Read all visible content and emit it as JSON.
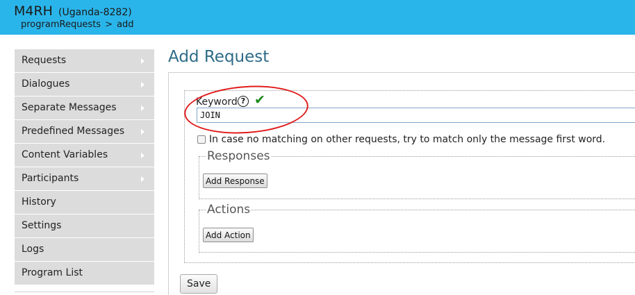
{
  "header": {
    "app_name": "M4RH",
    "program_name": "(Uganda-8282)",
    "breadcrumb": {
      "parent": "programRequests",
      "separator": ">",
      "current": "add"
    }
  },
  "sidebar": {
    "items": [
      {
        "label": "Requests",
        "has_submenu": true
      },
      {
        "label": "Dialogues",
        "has_submenu": true
      },
      {
        "label": "Separate Messages",
        "has_submenu": true
      },
      {
        "label": "Predefined Messages",
        "has_submenu": true
      },
      {
        "label": "Content Variables",
        "has_submenu": true
      },
      {
        "label": "Participants",
        "has_submenu": true
      },
      {
        "label": "History",
        "has_submenu": false
      },
      {
        "label": "Settings",
        "has_submenu": false
      },
      {
        "label": "Logs",
        "has_submenu": false
      },
      {
        "label": "Program List",
        "has_submenu": false
      }
    ]
  },
  "main": {
    "title": "Add Request",
    "keyword": {
      "label": "Keyword",
      "help_icon": "?",
      "value": "JOIN",
      "valid_icon": "✔"
    },
    "match_option": {
      "checked": false,
      "label": "In case no matching on other requests, try to match only the message first word."
    },
    "responses": {
      "legend": "Responses",
      "add_label": "Add Response"
    },
    "actions": {
      "legend": "Actions",
      "add_label": "Add Action"
    },
    "save_label": "Save"
  },
  "colors": {
    "header": "#2ab5ea",
    "title": "#2d6b87",
    "sidebar_bg": "#dcdcdc",
    "annotation": "#e01b1b",
    "valid": "#1b8a1b"
  }
}
